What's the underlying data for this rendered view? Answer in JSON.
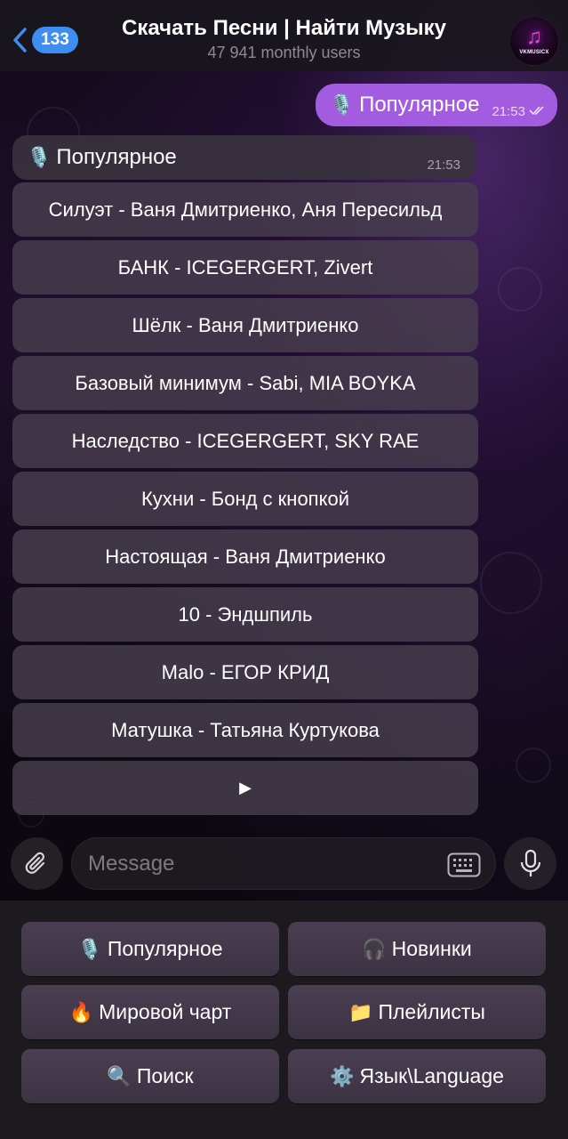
{
  "header": {
    "back_count": "133",
    "title": "Скачать Песни | Найти Музыку",
    "subtitle": "47 941 monthly users",
    "avatar_text": "VKMUSICX",
    "avatar_icon": "music-note-icon"
  },
  "outgoing_message": {
    "emoji": "🎙️",
    "text": "Популярное",
    "time": "21:53"
  },
  "incoming_message": {
    "emoji": "🎙️",
    "text": "Популярное",
    "time": "21:53"
  },
  "inline_buttons": [
    {
      "label": "Силуэт - Ваня Дмитриенко, Аня Пересильд"
    },
    {
      "label": "БАНК - ICEGERGERT, Zivert"
    },
    {
      "label": "Шёлк - Ваня Дмитриенко"
    },
    {
      "label": "Базовый минимум - Sabi, MIA BOYKA"
    },
    {
      "label": "Наследство - ICEGERGERT, SKY RAE"
    },
    {
      "label": "Кухни - Бонд с кнопкой"
    },
    {
      "label": "Настоящая - Ваня Дмитриенко"
    },
    {
      "label": "10 - Эндшпиль"
    },
    {
      "label": "Malo - ЕГОР КРИД"
    },
    {
      "label": "Матушка - Татьяна Куртукова"
    },
    {
      "label": "▶"
    }
  ],
  "composer": {
    "placeholder": "Message"
  },
  "reply_keyboard": [
    {
      "emoji": "🎙️",
      "label": "Популярное"
    },
    {
      "emoji": "🎧",
      "label": "Новинки"
    },
    {
      "emoji": "🔥",
      "label": "Мировой чарт"
    },
    {
      "emoji": "📁",
      "label": "Плейлисты"
    },
    {
      "emoji": "🔍",
      "label": "Поиск"
    },
    {
      "emoji": "⚙️",
      "label": "Язык\\Language"
    }
  ],
  "colors": {
    "accent": "#3d8ef0",
    "outgoing_bubble": "#a35be0",
    "keyboard_bg": "#1c1a1f"
  }
}
